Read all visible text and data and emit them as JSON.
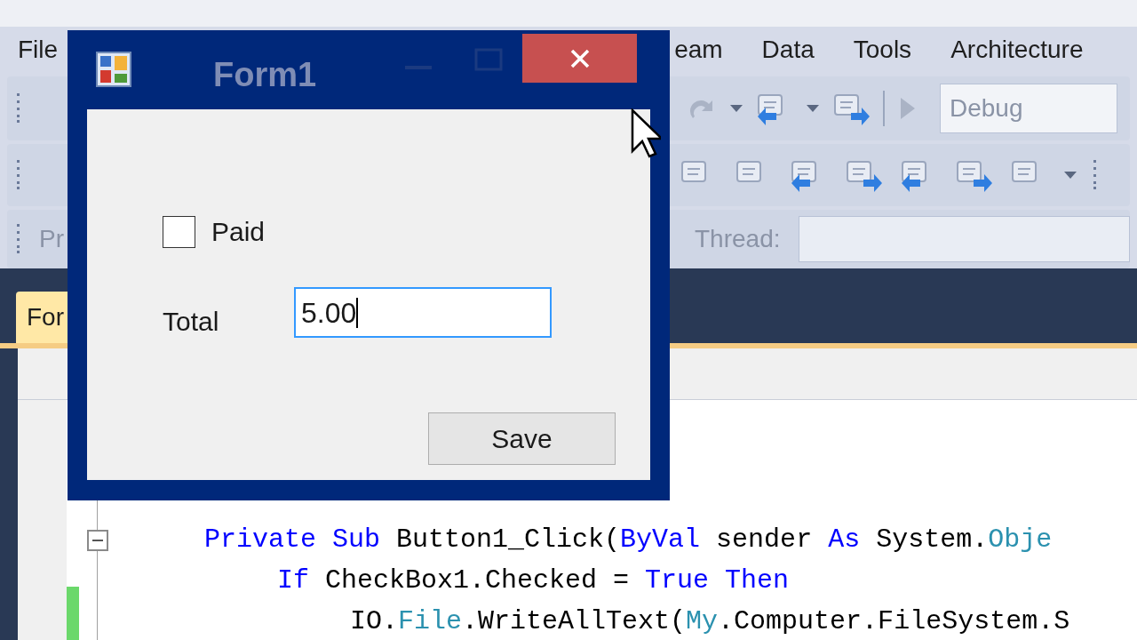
{
  "ide": {
    "menu": [
      "File",
      "eam",
      "Data",
      "Tools",
      "Architecture"
    ],
    "toolbar": {
      "config": "Debug",
      "row3_label": "Pr",
      "thread_label": "Thread:"
    },
    "tab": "For",
    "code": [
      {
        "tokens": [
          {
            "kind": "keyword",
            "text": "Private Sub"
          },
          {
            "kind": "plain",
            "text": " Button1_Click("
          },
          {
            "kind": "keyword",
            "text": "ByVal"
          },
          {
            "kind": "plain",
            "text": " sender "
          },
          {
            "kind": "keyword",
            "text": "As"
          },
          {
            "kind": "plain",
            "text": " System."
          },
          {
            "kind": "type",
            "text": "Obje"
          }
        ],
        "children": [
          {
            "tokens": [
              {
                "kind": "keyword",
                "text": "If"
              },
              {
                "kind": "plain",
                "text": " CheckBox1.Checked = "
              },
              {
                "kind": "keyword",
                "text": "True Then"
              }
            ],
            "children": [
              {
                "tokens": [
                  {
                    "kind": "plain",
                    "text": "IO."
                  },
                  {
                    "kind": "type",
                    "text": "File"
                  },
                  {
                    "kind": "plain",
                    "text": ".WriteAllText("
                  },
                  {
                    "kind": "type",
                    "text": "My"
                  },
                  {
                    "kind": "plain",
                    "text": ".Computer.FileSystem.S"
                  }
                ]
              }
            ]
          }
        ]
      }
    ]
  },
  "dialog": {
    "title": "Form1",
    "paid": {
      "label": "Paid",
      "checked": false
    },
    "total": {
      "label": "Total",
      "value": "5.00"
    },
    "button": "Save"
  }
}
